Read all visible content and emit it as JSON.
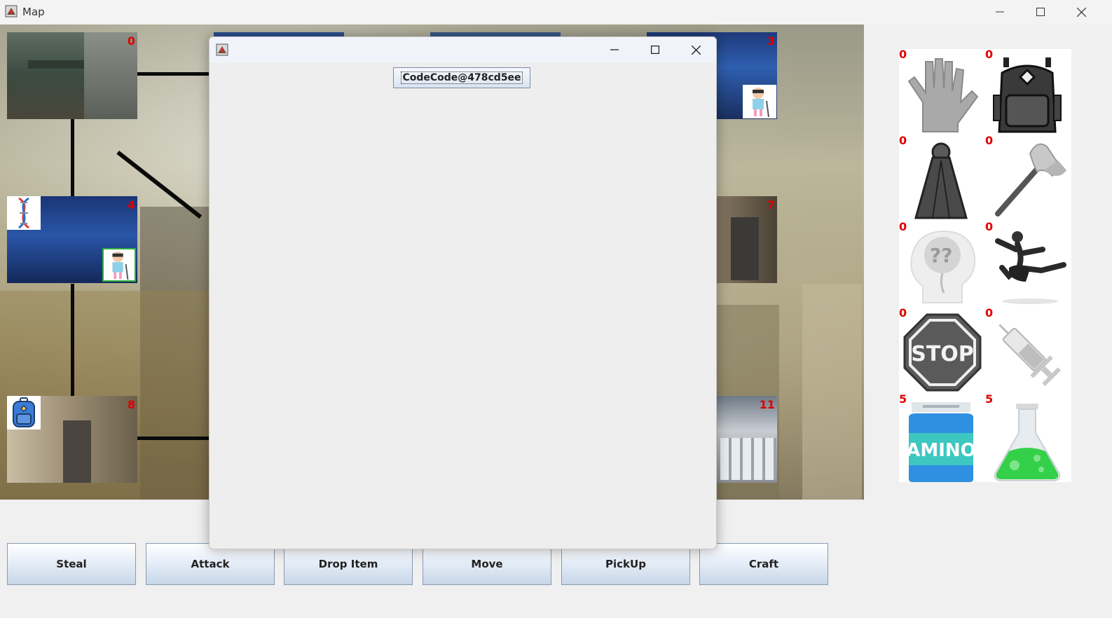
{
  "window": {
    "title": "Map",
    "app_icon": "java-app-icon",
    "controls": [
      "minimize-icon",
      "maximize-icon",
      "close-icon"
    ]
  },
  "map": {
    "rooms": [
      {
        "number": "0",
        "scene": "ruined-street"
      },
      {
        "number": "3",
        "scene": "blue-lab",
        "occupant": "player-icon"
      },
      {
        "number": "4",
        "scene": "blue-lab",
        "items": [
          "dna-icon"
        ],
        "occupant": "player-icon"
      },
      {
        "number": "7",
        "scene": "corridor"
      },
      {
        "number": "8",
        "scene": "basement-door",
        "items": [
          "backpack-icon"
        ]
      },
      {
        "number": "11",
        "scene": "warehouse"
      }
    ]
  },
  "dialog": {
    "title": "",
    "code_button_label": "CodeCode@478cd5ee"
  },
  "actions": {
    "steal": "Steal",
    "attack": "Attack",
    "drop_item": "Drop Item",
    "move": "Move",
    "pickup": "PickUp",
    "craft": "Craft"
  },
  "inventory": [
    {
      "name": "gloves-icon",
      "count": "0"
    },
    {
      "name": "backpack-icon",
      "count": "0"
    },
    {
      "name": "cloak-icon",
      "count": "0"
    },
    {
      "name": "axe-icon",
      "count": "0"
    },
    {
      "name": "brain-question-icon",
      "count": "0"
    },
    {
      "name": "dancer-icon",
      "count": "0"
    },
    {
      "name": "stop-sign-icon",
      "count": "0",
      "text": "STOP"
    },
    {
      "name": "syringe-icon",
      "count": "0"
    },
    {
      "name": "amino-jar-icon",
      "count": "5",
      "text": "AMINO"
    },
    {
      "name": "flask-icon",
      "count": "5"
    }
  ],
  "colors": {
    "count_text": "#e00000",
    "button_gradient_top": "#ffffff",
    "button_gradient_bottom": "#c7d6e8"
  }
}
